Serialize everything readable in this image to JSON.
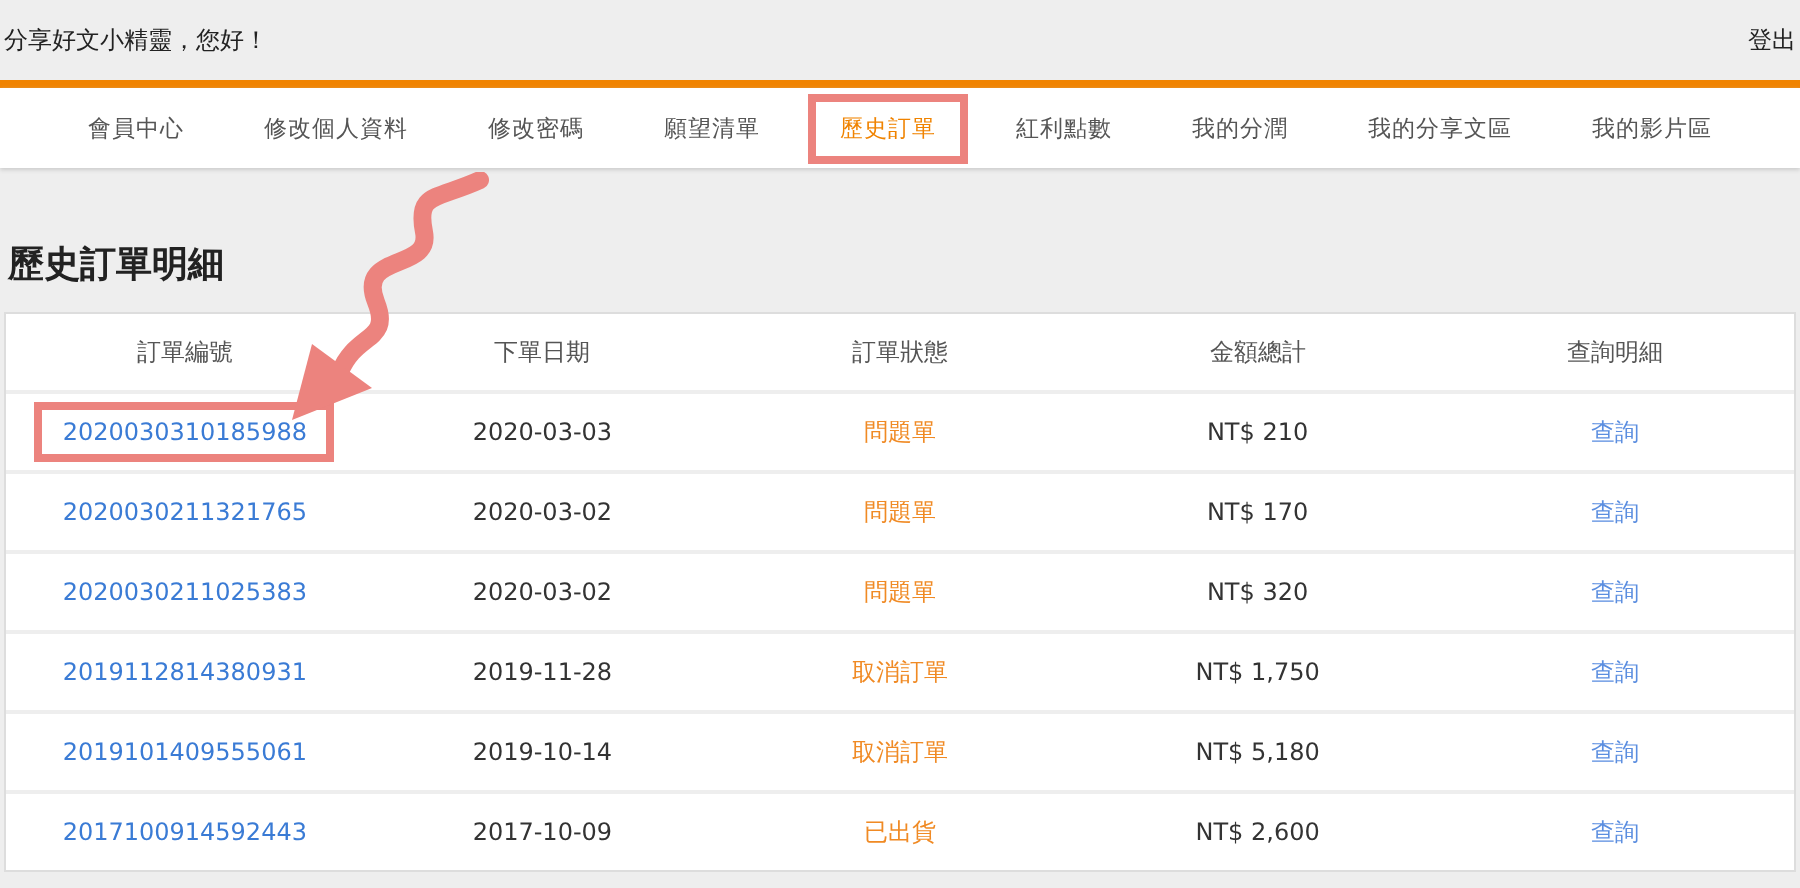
{
  "header": {
    "greeting": "分享好文小精靈，您好！",
    "logout": "登出"
  },
  "nav": [
    {
      "label": "會員中心",
      "selected": false
    },
    {
      "label": "修改個人資料",
      "selected": false
    },
    {
      "label": "修改密碼",
      "selected": false
    },
    {
      "label": "願望清單",
      "selected": false
    },
    {
      "label": "歷史訂單",
      "selected": true
    },
    {
      "label": "紅利點數",
      "selected": false
    },
    {
      "label": "我的分潤",
      "selected": false
    },
    {
      "label": "我的分享文區",
      "selected": false
    },
    {
      "label": "我的影片區",
      "selected": false
    }
  ],
  "page_title": "歷史訂單明細",
  "table": {
    "columns": [
      "訂單編號",
      "下單日期",
      "訂單狀態",
      "金額總計",
      "查詢明細"
    ],
    "rows": [
      {
        "order_no": "2020030310185988",
        "date": "2020-03-03",
        "status": "問題單",
        "total": "NT$ 210",
        "action": "查詢",
        "highlighted": true
      },
      {
        "order_no": "2020030211321765",
        "date": "2020-03-02",
        "status": "問題單",
        "total": "NT$ 170",
        "action": "查詢",
        "highlighted": false
      },
      {
        "order_no": "2020030211025383",
        "date": "2020-03-02",
        "status": "問題單",
        "total": "NT$ 320",
        "action": "查詢",
        "highlighted": false
      },
      {
        "order_no": "2019112814380931",
        "date": "2019-11-28",
        "status": "取消訂單",
        "total": "NT$ 1,750",
        "action": "查詢",
        "highlighted": false
      },
      {
        "order_no": "2019101409555061",
        "date": "2019-10-14",
        "status": "取消訂單",
        "total": "NT$ 5,180",
        "action": "查詢",
        "highlighted": false
      },
      {
        "order_no": "2017100914592443",
        "date": "2017-10-09",
        "status": "已出貨",
        "total": "NT$ 2,600",
        "action": "查詢",
        "highlighted": false
      }
    ]
  }
}
